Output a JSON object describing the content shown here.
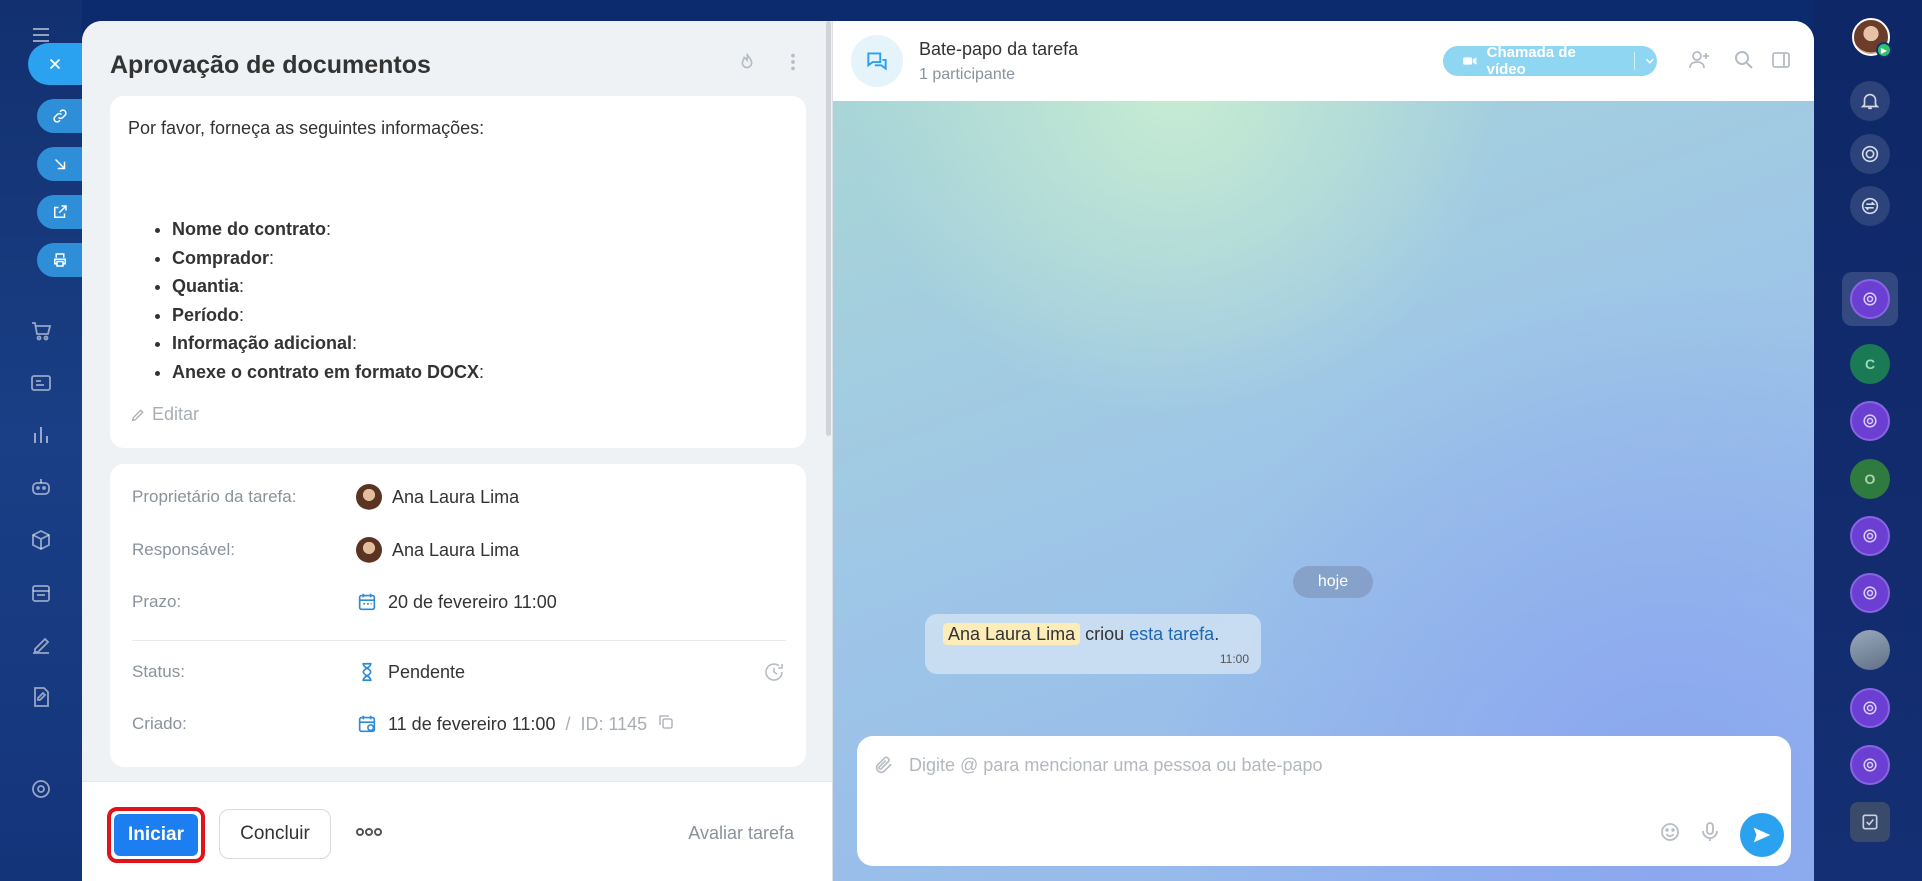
{
  "task": {
    "title": "Aprovação de documentos",
    "description_intro": "Por favor, forneça as seguintes informações:",
    "fields": [
      {
        "label": "Nome do contrato",
        "suffix": ":"
      },
      {
        "label": "Comprador",
        "suffix": ":"
      },
      {
        "label": "Quantia",
        "suffix": ":"
      },
      {
        "label": "Período",
        "suffix": ":"
      },
      {
        "label": "Informação adicional",
        "suffix": ":"
      },
      {
        "label": "Anexe o contrato em formato DOCX",
        "suffix": ":"
      }
    ],
    "edit_label": "Editar",
    "properties": {
      "owner_label": "Proprietário da tarefa:",
      "owner_value": "Ana Laura Lima",
      "responsible_label": "Responsável:",
      "responsible_value": "Ana Laura Lima",
      "deadline_label": "Prazo:",
      "deadline_value": "20 de fevereiro 11:00",
      "status_label": "Status:",
      "status_value": "Pendente",
      "created_label": "Criado:",
      "created_value": "11 de fevereiro 11:00",
      "id_sep": "/",
      "id_value": "ID: 1145"
    }
  },
  "footer": {
    "start_label": "Iniciar",
    "finish_label": "Concluir",
    "rate_label": "Avaliar tarefa"
  },
  "chat": {
    "title": "Bate-papo da tarefa",
    "subtitle": "1 participante",
    "video_call_label": "Chamada de vídeo",
    "date_label": "hoje",
    "message": {
      "mention": "Ana Laura Lima",
      "text": " criou ",
      "link": "esta tarefa",
      "end": ".",
      "time": "11:00"
    },
    "composer_placeholder": "Digite @ para mencionar uma pessoa ou bate-papo"
  },
  "right_bar": {
    "hex_letter": "C",
    "o_letter": "O"
  },
  "colors": {
    "primary": "#1c7ef0",
    "highlight_border": "#e0131a",
    "accent": "#2aa2f0"
  }
}
